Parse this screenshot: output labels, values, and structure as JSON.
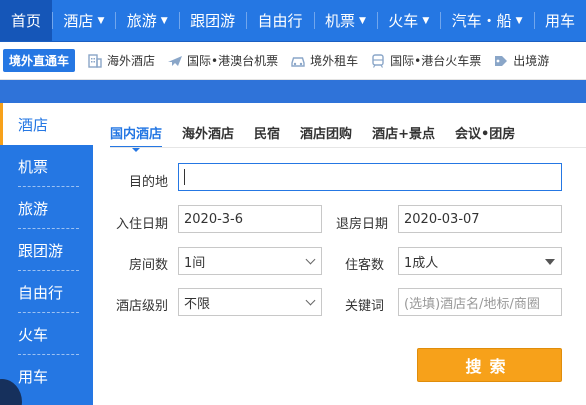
{
  "topnav": {
    "items": [
      {
        "label": "首页",
        "caret": false,
        "active": true
      },
      {
        "label": "酒店",
        "caret": true
      },
      {
        "label": "旅游",
        "caret": true
      },
      {
        "label": "跟团游",
        "caret": false
      },
      {
        "label": "自由行",
        "caret": false
      },
      {
        "label": "机票",
        "caret": true
      },
      {
        "label": "火车",
        "caret": true
      },
      {
        "label": "汽车・船",
        "caret": true
      },
      {
        "label": "用车",
        "caret": false
      }
    ],
    "caret_glyph": "▼"
  },
  "subnav": {
    "badge": "境外直通车",
    "items": [
      {
        "label": "海外酒店",
        "icon": "building-icon"
      },
      {
        "label": "国际•港澳台机票",
        "icon": "airplane-icon"
      },
      {
        "label": "境外租车",
        "icon": "car-icon"
      },
      {
        "label": "国际•港台火车票",
        "icon": "train-icon"
      },
      {
        "label": "出境游",
        "icon": "tag-icon"
      }
    ]
  },
  "sidebar": {
    "items": [
      {
        "label": "酒店",
        "active": true
      },
      {
        "label": "机票"
      },
      {
        "label": "旅游"
      },
      {
        "label": "跟团游"
      },
      {
        "label": "自由行"
      },
      {
        "label": "火车"
      },
      {
        "label": "用车"
      }
    ]
  },
  "tabs": [
    {
      "label": "国内酒店",
      "active": true
    },
    {
      "label": "海外酒店"
    },
    {
      "label": "民宿"
    },
    {
      "label": "酒店团购"
    },
    {
      "label": "酒店+景点"
    },
    {
      "label": "会议•团房"
    }
  ],
  "form": {
    "destination_label": "目的地",
    "destination_value": "",
    "checkin_label": "入住日期",
    "checkin_value": "2020-3-6",
    "checkout_label": "退房日期",
    "checkout_value": "2020-03-07",
    "rooms_label": "房间数",
    "rooms_value": "1间",
    "guests_label": "住客数",
    "guests_value": "1成人",
    "star_label": "酒店级别",
    "star_value": "不限",
    "keyword_label": "关键词",
    "keyword_placeholder": "(选填)酒店名/地标/商圈",
    "search_label": "搜索"
  },
  "colors": {
    "primary": "#2577e3",
    "accent": "#f7a11a"
  }
}
